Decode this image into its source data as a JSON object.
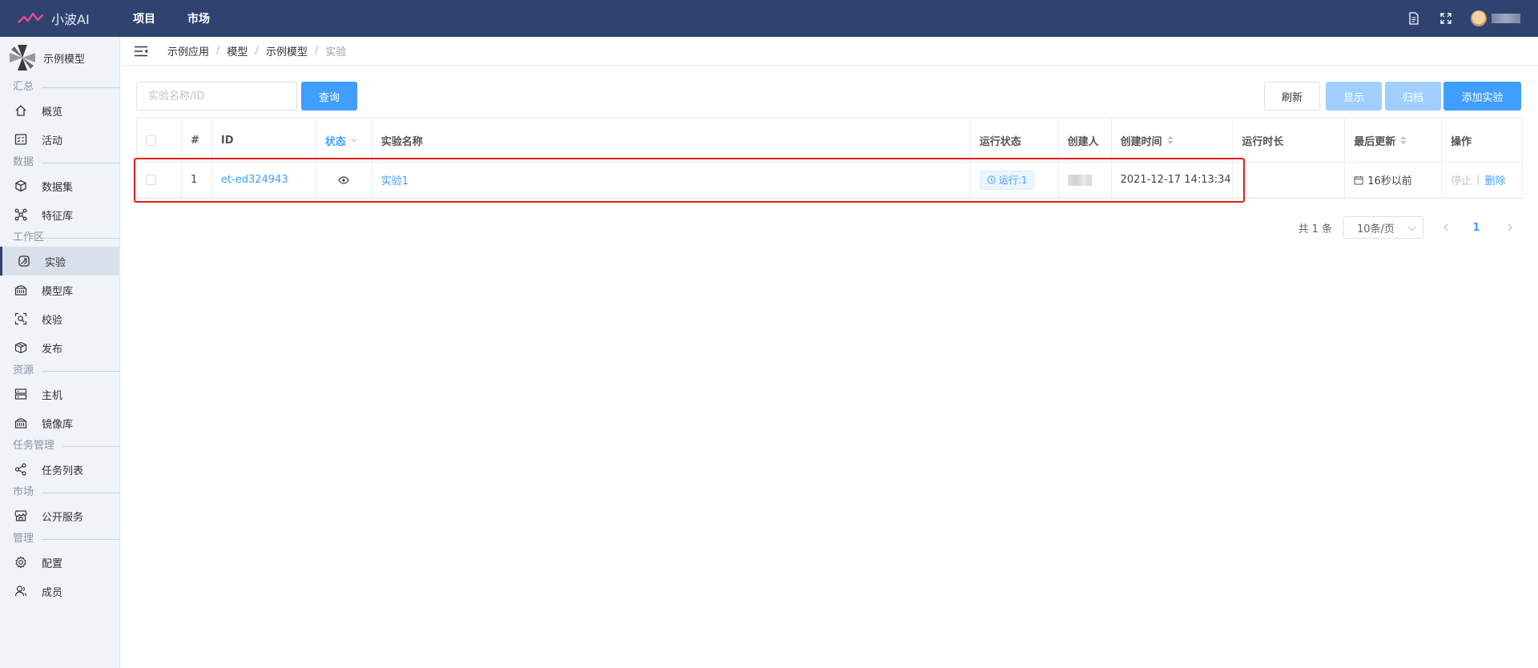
{
  "app": {
    "name": "小波AI",
    "nav": [
      "项目",
      "市场"
    ]
  },
  "sidebar": {
    "model_name": "示例模型",
    "sections": [
      {
        "title": "汇总",
        "items": [
          {
            "label": "概览",
            "icon": "home-icon"
          },
          {
            "label": "活动",
            "icon": "activity-icon"
          }
        ]
      },
      {
        "title": "数据",
        "items": [
          {
            "label": "数据集",
            "icon": "dataset-cube-icon"
          },
          {
            "label": "特征库",
            "icon": "feature-graph-icon"
          }
        ]
      },
      {
        "title": "工作区",
        "items": [
          {
            "label": "实验",
            "icon": "experiment-icon"
          },
          {
            "label": "模型库",
            "icon": "model-library-icon"
          },
          {
            "label": "校验",
            "icon": "inspect-icon"
          },
          {
            "label": "发布",
            "icon": "publish-box-icon"
          }
        ]
      },
      {
        "title": "资源",
        "items": [
          {
            "label": "主机",
            "icon": "server-icon"
          },
          {
            "label": "镜像库",
            "icon": "image-library-icon"
          }
        ]
      },
      {
        "title": "任务管理",
        "items": [
          {
            "label": "任务列表",
            "icon": "task-share-icon"
          }
        ]
      },
      {
        "title": "市场",
        "items": [
          {
            "label": "公开服务",
            "icon": "store-icon"
          }
        ]
      },
      {
        "title": "管理",
        "items": [
          {
            "label": "配置",
            "icon": "gear-icon"
          },
          {
            "label": "成员",
            "icon": "members-icon"
          }
        ]
      }
    ],
    "active": "实验"
  },
  "breadcrumb": [
    "示例应用",
    "模型",
    "示例模型",
    "实验"
  ],
  "toolbar": {
    "search_placeholder": "实验名称/ID",
    "query_label": "查询",
    "refresh_label": "刷新",
    "show_label": "显示",
    "archive_label": "归档",
    "add_label": "添加实验"
  },
  "table": {
    "headers": {
      "index": "#",
      "id": "ID",
      "status": "状态",
      "name": "实验名称",
      "run_status": "运行状态",
      "creator": "创建人",
      "created_at": "创建时间",
      "duration": "运行时长",
      "updated": "最后更新",
      "ops": "操作"
    },
    "rows": [
      {
        "index": "1",
        "id": "et-ed324943",
        "name": "实验1",
        "run_status": "运行:1",
        "created_at": "2021-12-17 14:13:34",
        "duration": "",
        "updated": "16秒以前",
        "op_stop": "停止",
        "op_delete": "删除"
      }
    ]
  },
  "pagination": {
    "total": "共 1 条",
    "page_size": "10条/页",
    "current": "1"
  },
  "colors": {
    "topbar": "#2f4370",
    "primary": "#409eff",
    "highlight": "#e01e1e"
  }
}
